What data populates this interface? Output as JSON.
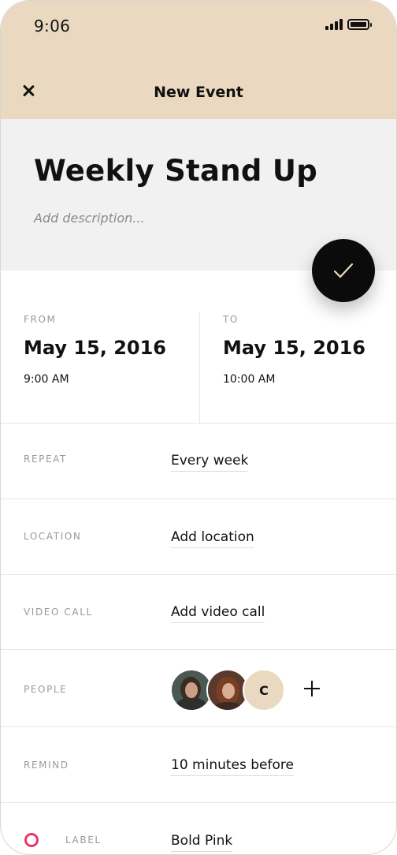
{
  "status_bar": {
    "time": "9:06",
    "signal_icon": "cellular-signal-icon",
    "battery_icon": "battery-icon"
  },
  "header": {
    "title": "New Event",
    "close_icon": "close-icon"
  },
  "event": {
    "title": "Weekly Stand Up",
    "description_placeholder": "Add description...",
    "confirm_icon": "checkmark-icon"
  },
  "from": {
    "label": "FROM",
    "date": "May 15, 2016",
    "time": "9:00 AM"
  },
  "to": {
    "label": "TO",
    "date": "May 15, 2016",
    "time": "10:00 AM"
  },
  "rows": {
    "repeat": {
      "label": "REPEAT",
      "value": "Every week"
    },
    "location": {
      "label": "LOCATION",
      "value": "Add location"
    },
    "video_call": {
      "label": "VIDEO CALL",
      "value": "Add video call"
    },
    "people": {
      "label": "PEOPLE",
      "avatar_initial": "C",
      "add_icon": "plus-icon"
    },
    "remind": {
      "label": "REMIND",
      "value": "10 minutes before"
    },
    "label": {
      "label": "LABEL",
      "value": "Bold Pink",
      "color": "#e8386a"
    }
  },
  "colors": {
    "accent": "#ead9c0",
    "title_bg": "#f1f1f1",
    "fab": "#0b0b0b",
    "check": "#ead9c0"
  }
}
